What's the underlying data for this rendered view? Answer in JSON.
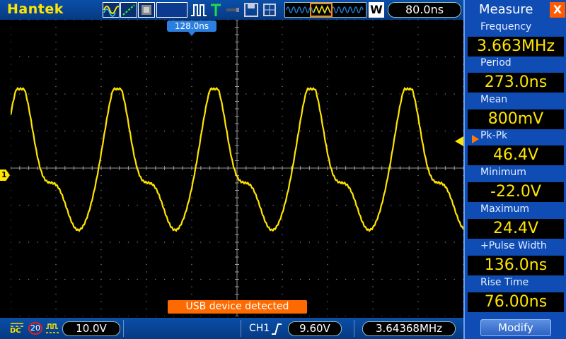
{
  "topbar": {
    "brand": "Hantek",
    "timebase": "80.0ns",
    "mode_letter": "W"
  },
  "screen": {
    "trigger_position": "128.0ns",
    "channel_marker": "1",
    "status_message": "USB device detected"
  },
  "bottombar": {
    "coupling": "DC",
    "bandwidth_limit": "20",
    "volts_per_div": "10.0V",
    "trigger_channel": "CH1",
    "trigger_level": "9.60V",
    "frequency": "3.64368MHz"
  },
  "panel": {
    "title": "Measure",
    "close": "X",
    "measurements": [
      {
        "label": "Frequency",
        "value": "3.663MHz"
      },
      {
        "label": "Period",
        "value": "273.0ns"
      },
      {
        "label": "Mean",
        "value": "800mV"
      },
      {
        "label": "Pk-Pk",
        "value": "46.4V"
      },
      {
        "label": "Minimum",
        "value": "-22.0V"
      },
      {
        "label": "Maximum",
        "value": "24.4V"
      },
      {
        "label": "+Pulse Width",
        "value": "136.0ns"
      },
      {
        "label": "Rise Time",
        "value": "76.00ns"
      }
    ],
    "modify_label": "Modify"
  },
  "colors": {
    "trace": "#ffe500",
    "bar_blue": "#0a4fa8",
    "panel_blue": "#0f4db5",
    "accent_orange": "#ff6a00"
  }
}
